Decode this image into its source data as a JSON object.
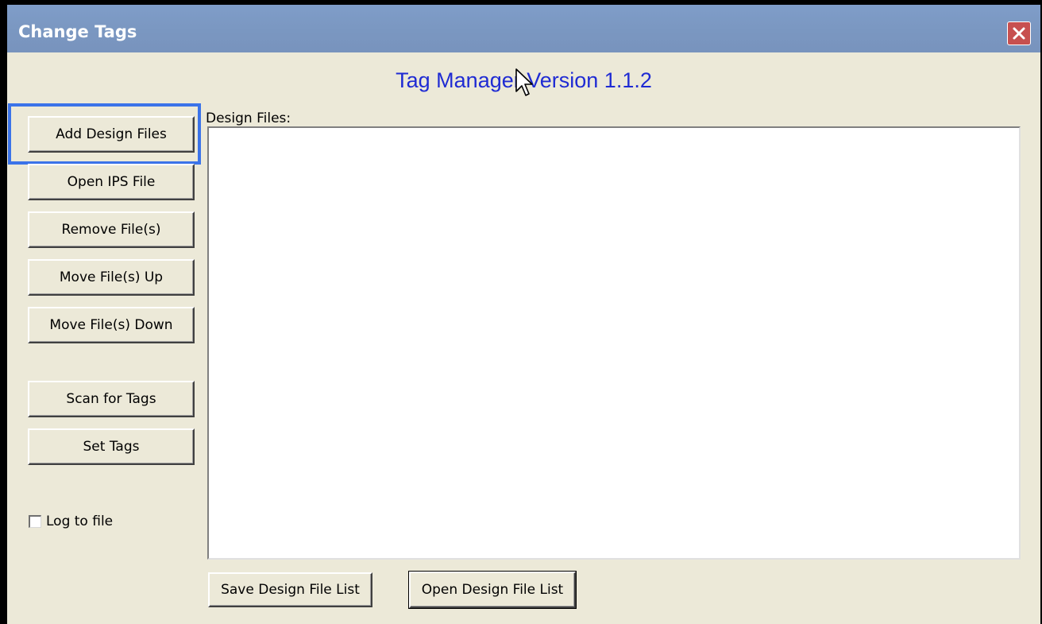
{
  "window": {
    "title": "Change Tags",
    "close_icon": "close-icon"
  },
  "header": {
    "title": "Tag Manager Version 1.1.2"
  },
  "sidebar": {
    "buttons": [
      {
        "label": "Add Design Files"
      },
      {
        "label": "Open IPS File"
      },
      {
        "label": "Remove File(s)"
      },
      {
        "label": "Move File(s) Up"
      },
      {
        "label": "Move File(s) Down"
      },
      {
        "label": "Scan for Tags"
      },
      {
        "label": "Set Tags"
      }
    ],
    "log_to_file": {
      "label": "Log to file",
      "checked": false
    }
  },
  "main": {
    "files_label": "Design Files:",
    "files": []
  },
  "footer": {
    "save_label": "Save Design File List",
    "open_label": "Open Design File List"
  },
  "colors": {
    "titlebar": "#7b98c2",
    "header_text": "#1f2bd3",
    "focus_ring": "#3b73e9",
    "close_button": "#c75050"
  }
}
